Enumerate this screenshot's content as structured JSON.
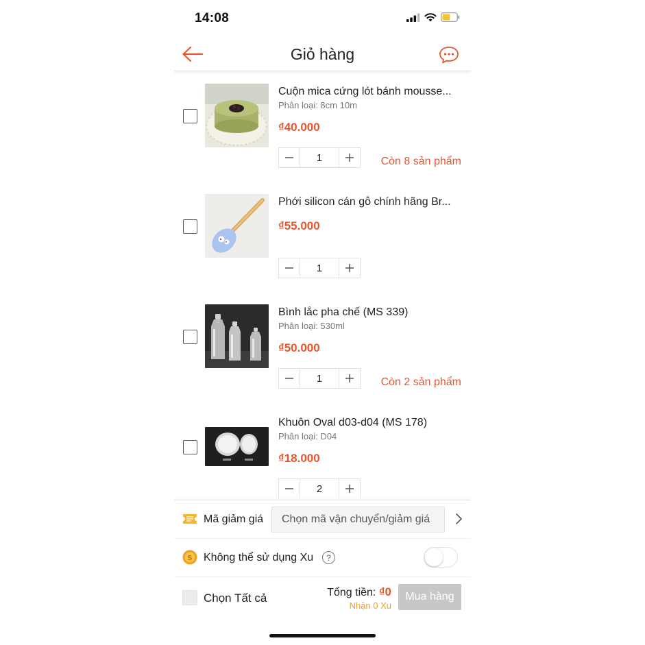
{
  "status_bar": {
    "time": "14:08"
  },
  "header": {
    "title": "Giỏ hàng"
  },
  "cart_items": [
    {
      "name": "Cuộn mica cứng lót bánh mousse...",
      "variant": "Phân loại: 8cm 10m",
      "price": "₫40.000",
      "quantity": "1",
      "stock_note": "Còn 8 sản phẩm",
      "thumb": "mousse-cake"
    },
    {
      "name": "Phới silicon cán gỗ chính hãng Br...",
      "variant": "",
      "price": "₫55.000",
      "quantity": "1",
      "stock_note": "",
      "thumb": "silicone-spatula"
    },
    {
      "name": "Bình lắc pha chế (MS 339)",
      "variant": "Phân loại: 530ml",
      "price": "₫50.000",
      "quantity": "1",
      "stock_note": "Còn 2 sản phẩm",
      "thumb": "cocktail-shakers"
    },
    {
      "name": "Khuôn Oval d03-d04 (MS 178)",
      "variant": "Phân loại: D04",
      "price": "₫18.000",
      "quantity": "2",
      "stock_note": "",
      "thumb": "oval-molds"
    }
  ],
  "voucher": {
    "label": "Mã giảm giá",
    "placeholder": "Chọn mã vận chuyển/giảm giá"
  },
  "coins": {
    "label": "Không thể sử dụng Xu",
    "help": "?"
  },
  "checkout": {
    "select_all": "Chọn Tất cả",
    "total_label": "Tổng tiền:",
    "total_value": "₫0",
    "xu_earned": "Nhận 0 Xu",
    "buy_label": "Mua hàng"
  },
  "colors": {
    "accent": "#e4572e",
    "coin": "#f0a020",
    "disabled_button": "#c7c7c7"
  }
}
